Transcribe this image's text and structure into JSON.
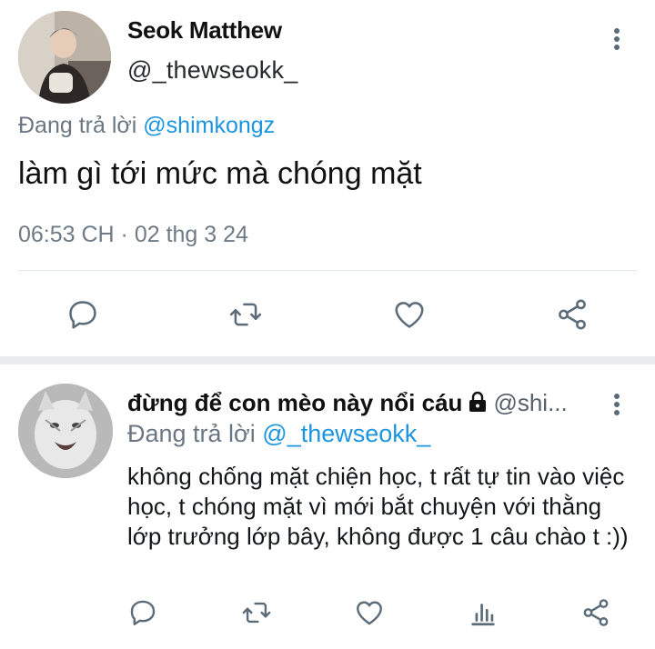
{
  "tweet": {
    "author_name": "Seok Matthew",
    "author_handle": "@_thewseokk_",
    "reply_prefix": "Đang trả lời",
    "reply_to": "@shimkongz",
    "text": "làm gì tới mức mà chóng mặt",
    "timestamp": "06:53 CH · 02 thg 3 24",
    "actions": [
      "reply-icon",
      "retweet-icon",
      "like-icon",
      "share-icon"
    ]
  },
  "reply": {
    "author_name": "đừng để con mèo này nổi cáu",
    "author_handle": "@shi...",
    "protected_icon": "lock-icon",
    "reply_prefix": "Đang trả lời",
    "reply_to": "@_thewseokk_",
    "text": "không chống mặt chiện học, t rất tự tin vào việc học, t chóng mặt vì mới bắt chuyện với thằng lớp trưởng lớp bây, không được 1 câu chào t :))",
    "actions": [
      "reply-icon",
      "retweet-icon",
      "like-icon",
      "analytics-icon",
      "share-icon"
    ]
  },
  "colors": {
    "accent": "#1b95e0",
    "icon": "#5b6b78",
    "muted": "#6e7b86",
    "divider": "#e3e8ec"
  }
}
